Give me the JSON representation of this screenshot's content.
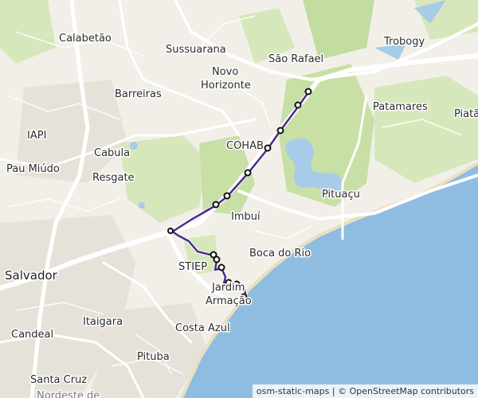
{
  "map": {
    "attribution": {
      "generator": "osm-static-maps",
      "separator": "|",
      "copyright": "© OpenStreetMap contributors"
    },
    "places": [
      {
        "name": "Calabetão"
      },
      {
        "name": "Sussuarana"
      },
      {
        "name": "Trobogy"
      },
      {
        "name": "São Rafael"
      },
      {
        "name": "Novo"
      },
      {
        "name": "Horizonte"
      },
      {
        "name": "Barreiras"
      },
      {
        "name": "Patamares"
      },
      {
        "name": "Piatã"
      },
      {
        "name": "IAPI"
      },
      {
        "name": "COHAB"
      },
      {
        "name": "Cabula"
      },
      {
        "name": "Pau Miúdo"
      },
      {
        "name": "Resgate"
      },
      {
        "name": "Pituaçu"
      },
      {
        "name": "Imbuí"
      },
      {
        "name": "Boca do Rio"
      },
      {
        "name": "STIEP"
      },
      {
        "name": "Salvador"
      },
      {
        "name": "Jardim"
      },
      {
        "name": "Armação"
      },
      {
        "name": "Candeal"
      },
      {
        "name": "Itaigara"
      },
      {
        "name": "Costa Azul"
      },
      {
        "name": "Pituba"
      },
      {
        "name": "Santa Cruz"
      },
      {
        "name": "Nordeste de"
      }
    ],
    "colors": {
      "land": "#f2efe9",
      "park": "#d3e6b6",
      "forest": "#c3dca0",
      "water": "#9ec8e8",
      "sea": "#8fbde2",
      "urban": "#e4e0d8",
      "road": "#ffffff",
      "route": "#4b2b8f"
    },
    "route": {
      "name": "",
      "stops": 14
    }
  }
}
